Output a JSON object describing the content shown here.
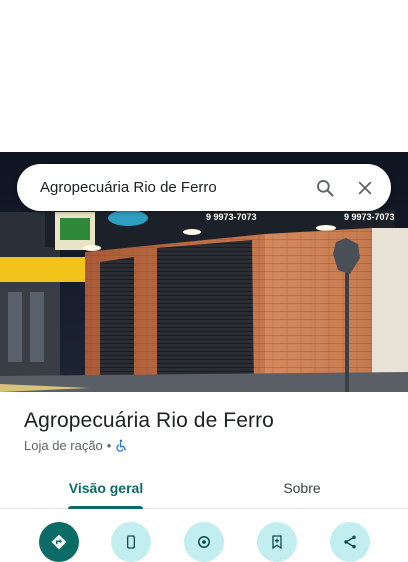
{
  "search": {
    "value": "Agropecuária Rio de Ferro"
  },
  "photo": {
    "sign_phone_left": "9 9973-7073",
    "sign_phone_right": "9 9973-7073"
  },
  "place": {
    "name": "Agropecuária Rio de Ferro",
    "category": "Loja de ração",
    "separator": "•"
  },
  "tabs": [
    {
      "label": "Visão geral",
      "active": true
    },
    {
      "label": "Sobre",
      "active": false
    }
  ],
  "actions": [
    {
      "icon": "directions-icon"
    },
    {
      "icon": "phone-icon"
    },
    {
      "icon": "location-icon"
    },
    {
      "icon": "save-icon"
    },
    {
      "icon": "share-icon"
    }
  ],
  "colors": {
    "accent": "#0b6b66",
    "action_bg": "#c3eef0",
    "title": "#202124"
  }
}
